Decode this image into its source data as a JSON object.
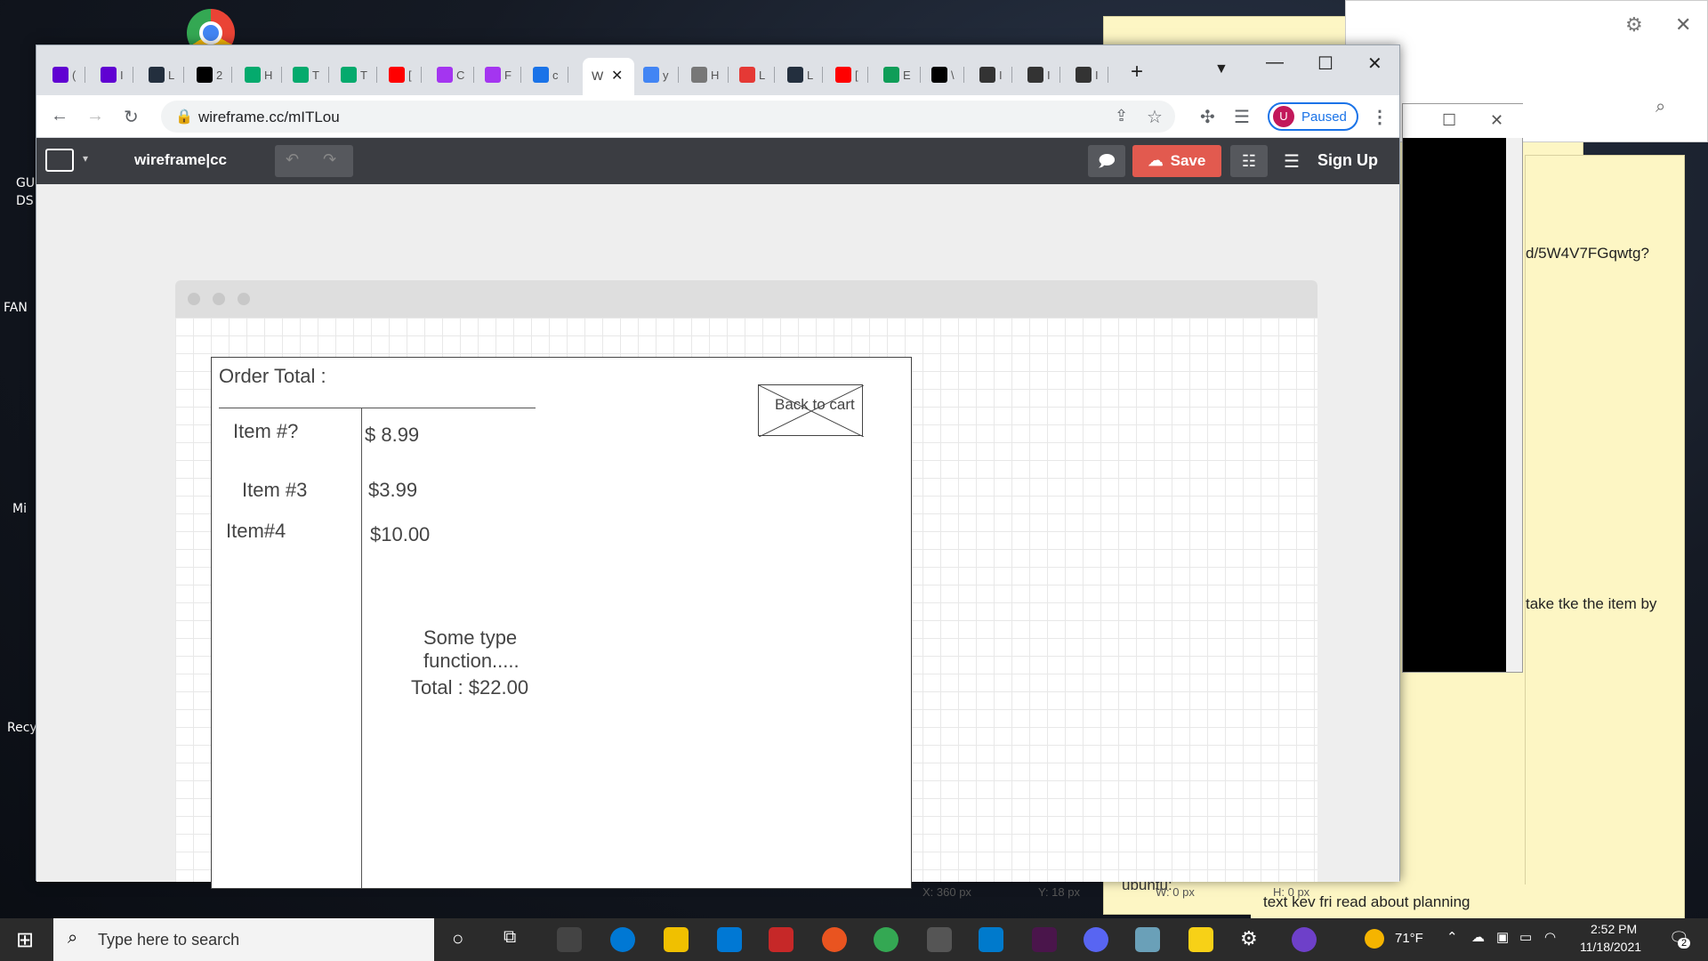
{
  "desktop": {
    "labels": [
      "GU",
      "DS",
      "FAN",
      "Mi",
      "Recy"
    ]
  },
  "background_windows": {
    "sticky_bottom_text": "text kev fri read about planning",
    "sticky_url_fragment": "d/5W4V7FGqwtg?",
    "sticky_mid_text": "take tke the item by",
    "sticky_ubuntu": "ubuntu:"
  },
  "browser": {
    "tabs": [
      {
        "icon": "mail-icon",
        "text": "(",
        "color": "#6001d2"
      },
      {
        "icon": "yahoo-icon",
        "text": "I",
        "color": "#6001d2"
      },
      {
        "icon": "aws-icon",
        "text": "L",
        "color": "#232f3e"
      },
      {
        "icon": "dev-icon",
        "text": "2",
        "color": "#000000"
      },
      {
        "icon": "w3-icon",
        "text": "H",
        "color": "#04aa6d"
      },
      {
        "icon": "w3-icon",
        "text": "T",
        "color": "#04aa6d"
      },
      {
        "icon": "w3-icon",
        "text": "T",
        "color": "#04aa6d"
      },
      {
        "icon": "youtube-icon",
        "text": "[",
        "color": "#ff0000"
      },
      {
        "icon": "udemy-icon",
        "text": "C",
        "color": "#a435f0"
      },
      {
        "icon": "udemy-icon",
        "text": "F",
        "color": "#a435f0"
      },
      {
        "icon": "fd-icon",
        "text": "c",
        "color": "#1a73e8"
      }
    ],
    "active_tab": {
      "icon": "wireframe-icon",
      "text": "W"
    },
    "tabs_right": [
      {
        "icon": "google-icon",
        "text": "y",
        "color": "#4285f4"
      },
      {
        "icon": "hashnode-icon",
        "text": "H",
        "color": "#777777"
      },
      {
        "icon": "lifesaver-icon",
        "text": "L",
        "color": "#e53935"
      },
      {
        "icon": "aws-icon",
        "text": "L",
        "color": "#232f3e"
      },
      {
        "icon": "youtube-icon",
        "text": "[",
        "color": "#ff0000"
      },
      {
        "icon": "edge-icon",
        "text": "E",
        "color": "#0f9d58"
      },
      {
        "icon": "hn-icon",
        "text": "\\",
        "color": "#000000"
      },
      {
        "icon": "github-icon",
        "text": "I",
        "color": "#333333"
      },
      {
        "icon": "github-icon",
        "text": "I",
        "color": "#333333"
      },
      {
        "icon": "github-icon",
        "text": "I",
        "color": "#333333"
      }
    ],
    "url": "wireframe.cc/mITLou",
    "profile_initial": "U",
    "profile_status": "Paused"
  },
  "app": {
    "brand": "wireframe|cc",
    "save_label": "Save",
    "signup_label": "Sign Up"
  },
  "wireframe": {
    "order_total_label": "Order Total :",
    "items": [
      {
        "name": "Item #?",
        "price": "$ 8.99"
      },
      {
        "name": "Item #3",
        "price": "$3.99"
      },
      {
        "name": "Item#4",
        "price": "$10.00"
      }
    ],
    "note_line1": "Some type",
    "note_line2": "function.....",
    "total_line": "Total : $22.00",
    "back_to_cart": "Back to cart"
  },
  "status_bar": {
    "x": "X: 360 px",
    "y": "Y: 18 px",
    "w": "W: 0 px",
    "h": "H: 0 px"
  },
  "taskbar": {
    "search_placeholder": "Type here to search",
    "weather": "71°F",
    "time": "2:52 PM",
    "date": "11/18/2021",
    "notification_count": "2"
  }
}
